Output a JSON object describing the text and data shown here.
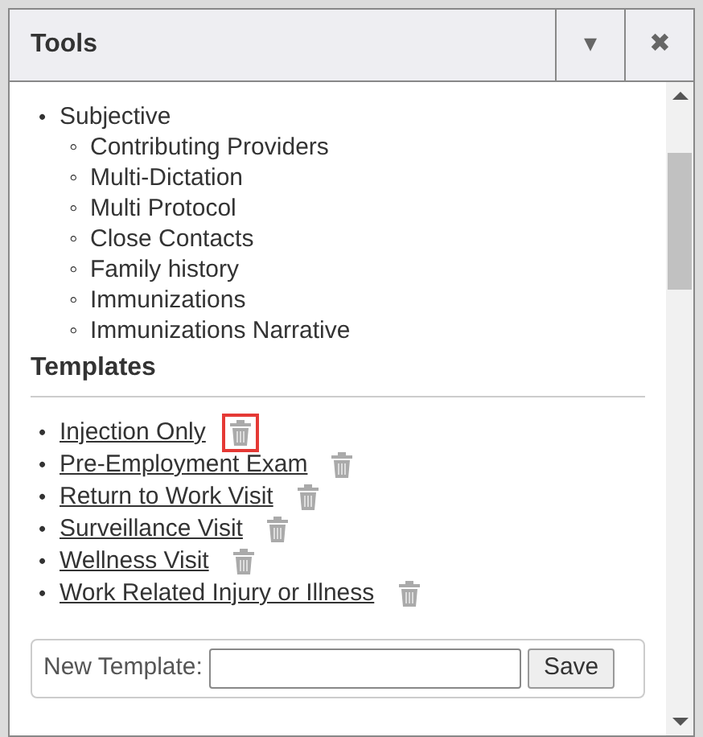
{
  "dialog": {
    "title": "Tools",
    "menu_button": "▾",
    "close_button": "✖"
  },
  "outline": [
    {
      "marker": "•",
      "label": "Subjective",
      "children": [
        {
          "marker": "◦",
          "label": "Contributing Providers"
        },
        {
          "marker": "◦",
          "label": "Multi-Dictation"
        },
        {
          "marker": "◦",
          "label": "Multi Protocol"
        },
        {
          "marker": "◦",
          "label": "Close Contacts"
        },
        {
          "marker": "◦",
          "label": "Family history"
        },
        {
          "marker": "◦",
          "label": "Immunizations"
        },
        {
          "marker": "◦",
          "label": "Immunizations Narrative"
        }
      ]
    }
  ],
  "templates_heading": "Templates",
  "templates": [
    {
      "marker": "•",
      "label": "Injection Only",
      "highlighted": true
    },
    {
      "marker": "•",
      "label": "Pre-Employment Exam",
      "highlighted": false
    },
    {
      "marker": "•",
      "label": "Return to Work Visit",
      "highlighted": false
    },
    {
      "marker": "•",
      "label": "Surveillance Visit",
      "highlighted": false
    },
    {
      "marker": "•",
      "label": "Wellness Visit",
      "highlighted": false
    },
    {
      "marker": "•",
      "label": "Work Related Injury or Illness",
      "highlighted": false
    }
  ],
  "new_template": {
    "label": "New Template:",
    "button": "Save"
  }
}
